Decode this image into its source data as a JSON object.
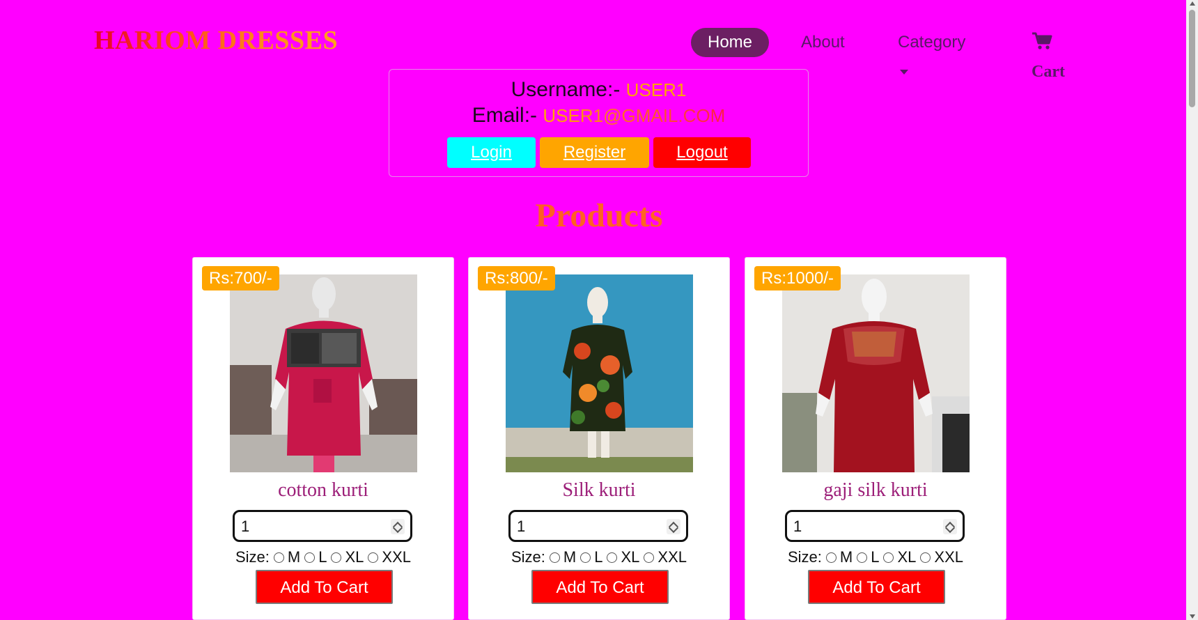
{
  "brand": "HARIOM DRESSES",
  "nav": {
    "home": "Home",
    "about": "About",
    "category": "Category",
    "cart": "Cart"
  },
  "user": {
    "username_label": "Username:-",
    "username_value": "USER1",
    "email_label": "Email:-",
    "email_value": "USER1@GMAIL.COM",
    "login": "Login",
    "register": "Register",
    "logout": "Logout"
  },
  "products_title": "Products",
  "size_label": "Size:",
  "sizes": [
    "M",
    "L",
    "XL",
    "XXL"
  ],
  "add_to_cart": "Add To Cart",
  "products": [
    {
      "price": "Rs:700/-",
      "name": "cotton kurti",
      "quantity": "1"
    },
    {
      "price": "Rs:800/-",
      "name": "Silk kurti",
      "quantity": "1"
    },
    {
      "price": "Rs:1000/-",
      "name": "gaji silk kurti",
      "quantity": "1"
    }
  ],
  "colors": {
    "background": "#ff00ff",
    "home_pill": "#6c1f63",
    "login": "#00ffff",
    "register": "#ffa500",
    "logout": "#ff0000",
    "price_badge": "#ffa500",
    "add_to_cart": "#ff0000"
  }
}
